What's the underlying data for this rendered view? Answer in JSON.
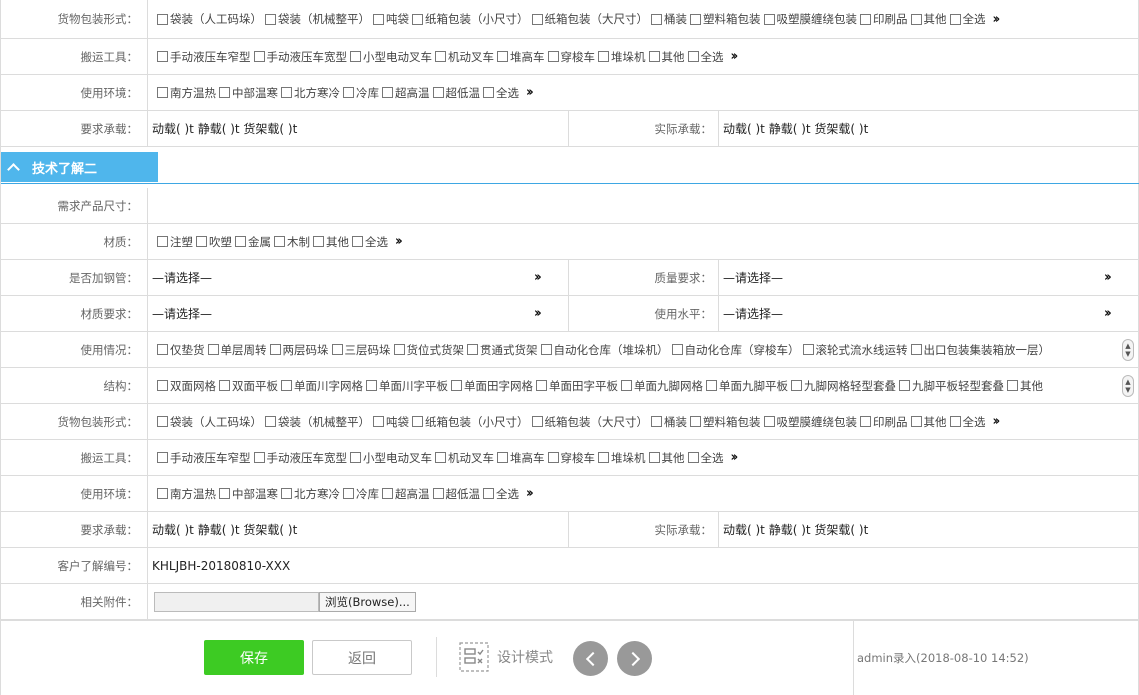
{
  "packaging": {
    "label": "货物包装形式：",
    "options": [
      "袋装（人工码垛）",
      "袋装（机械整平）",
      "吨袋",
      "纸箱包装（小尺寸）",
      "纸箱包装（大尺寸）",
      "桶装",
      "塑料箱包装",
      "吸塑膜缠绕包装",
      "印刷品",
      "其他",
      "全选"
    ]
  },
  "transport": {
    "label": "搬运工具：",
    "options": [
      "手动液压车窄型",
      "手动液压车宽型",
      "小型电动叉车",
      "机动叉车",
      "堆高车",
      "穿梭车",
      "堆垛机",
      "其他",
      "全选"
    ]
  },
  "environment": {
    "label": "使用环境：",
    "options": [
      "南方温热",
      "中部温寒",
      "北方寒冷",
      "冷库",
      "超高温",
      "超低温",
      "全选"
    ]
  },
  "load": {
    "required_label": "要求承载：",
    "actual_label": "实际承载：",
    "text": "动载(      )t    静载(      )t   货架载(      )t"
  },
  "section2": {
    "title": "技术了解二"
  },
  "product_size": {
    "label": "需求产品尺寸："
  },
  "material": {
    "label": "材质：",
    "options": [
      "注塑",
      "吹塑",
      "金属",
      "木制",
      "其他",
      "全选"
    ]
  },
  "steel_pipe": {
    "label": "是否加钢管：",
    "value": "—请选择—"
  },
  "quality": {
    "label": "质量要求：",
    "value": "—请选择—"
  },
  "material_req": {
    "label": "材质要求：",
    "value": "—请选择—"
  },
  "usage_level": {
    "label": "使用水平：",
    "value": "—请选择—"
  },
  "usage": {
    "label": "使用情况：",
    "options": [
      "仅垫货",
      "单层周转",
      "两层码垛",
      "三层码垛",
      "货位式货架",
      "贯通式货架",
      "自动化仓库（堆垛机）",
      "自动化仓库（穿梭车）",
      "滚轮式流水线运转",
      "出口包装集装箱放一层）"
    ]
  },
  "structure": {
    "label": "结构：",
    "options": [
      "双面网格",
      "双面平板",
      "单面川字网格",
      "单面川字平板",
      "单面田字网格",
      "单面田字平板",
      "单面九脚网格",
      "单面九脚平板",
      "九脚网格轻型套叠",
      "九脚平板轻型套叠",
      "其他"
    ]
  },
  "customer_no": {
    "label": "客户了解编号：",
    "value": "KHLJBH-20180810-XXX"
  },
  "attachment": {
    "label": "相关附件：",
    "browse_label": "浏览(Browse)..."
  },
  "footer": {
    "save_label": "保存",
    "back_label": "返回",
    "design_label": "设计模式",
    "info": "admin录入(2018-08-10 14:52)"
  },
  "colors": {
    "accent": "#4fb6ec",
    "save": "#3dcb23",
    "nav_circle": "#999999"
  }
}
